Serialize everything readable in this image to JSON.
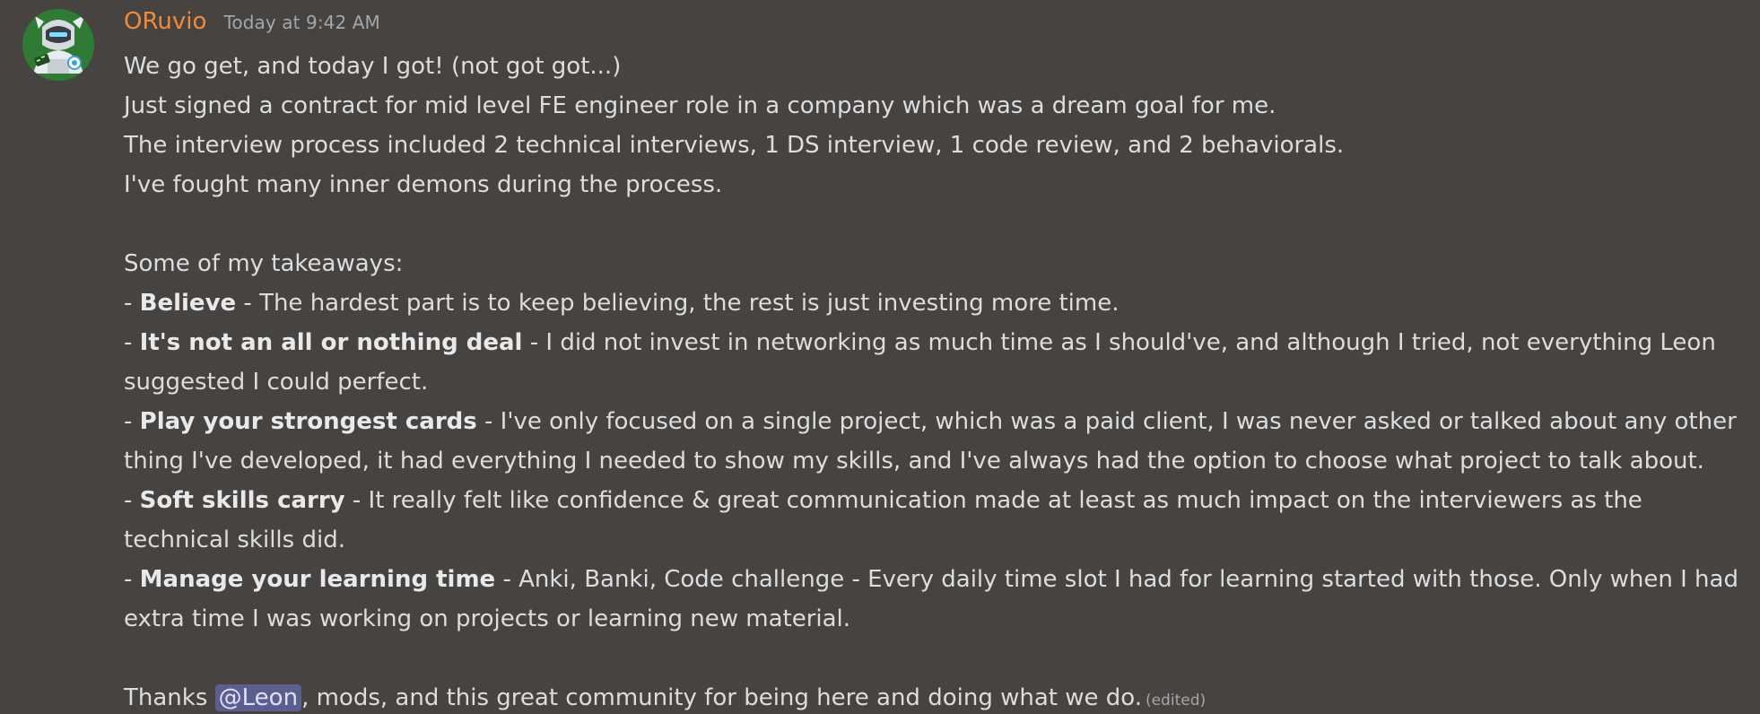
{
  "author": {
    "name": "ORuvio",
    "timestamp": "Today at 9:42 AM",
    "name_color": "#f08a3c"
  },
  "message": {
    "intro": [
      "We go get, and today I got! (not got got...)",
      "Just signed a contract for mid level FE engineer role in a company which was a dream goal for me.",
      "The interview process included 2 technical interviews, 1 DS interview, 1 code review, and 2 behaviorals.",
      "I've fought many inner demons during the process."
    ],
    "takeaways_heading": "Some of my takeaways:",
    "takeaways": [
      {
        "prefix": "- ",
        "term": "Believe",
        "text": " - The hardest part is to keep believing, the rest is just investing more time."
      },
      {
        "prefix": "- ",
        "term": "It's not an all or nothing deal",
        "text": " - I did not invest in networking as much time as I should've, and although I tried, not everything Leon suggested I could perfect."
      },
      {
        "prefix": "- ",
        "term": "Play your strongest cards",
        "text": " - I've only focused on a single project, which was a paid client, I was never asked or talked about any other thing I've developed, it had everything I needed to show my skills, and I've always had the option to choose what project to talk about."
      },
      {
        "prefix": "- ",
        "term": "Soft skills carry",
        "text": " - It really felt like confidence & great communication made at least as much impact on the interviewers  as the technical skills did."
      },
      {
        "prefix": "- ",
        "term": "Manage your learning time",
        "text": " - Anki, Banki, Code challenge - Every daily time slot I had for learning started with those. Only when I had extra time I was working on projects or learning new material."
      }
    ],
    "thanks_before": "Thanks ",
    "mention": "@Leon",
    "thanks_after": ", mods, and this great community for being here and doing what we do.",
    "edited": "(edited)"
  },
  "colors": {
    "background": "#474340",
    "mention_bg": "#5a5f8d"
  },
  "icons": {
    "avatar": "robot-character-avatar"
  }
}
